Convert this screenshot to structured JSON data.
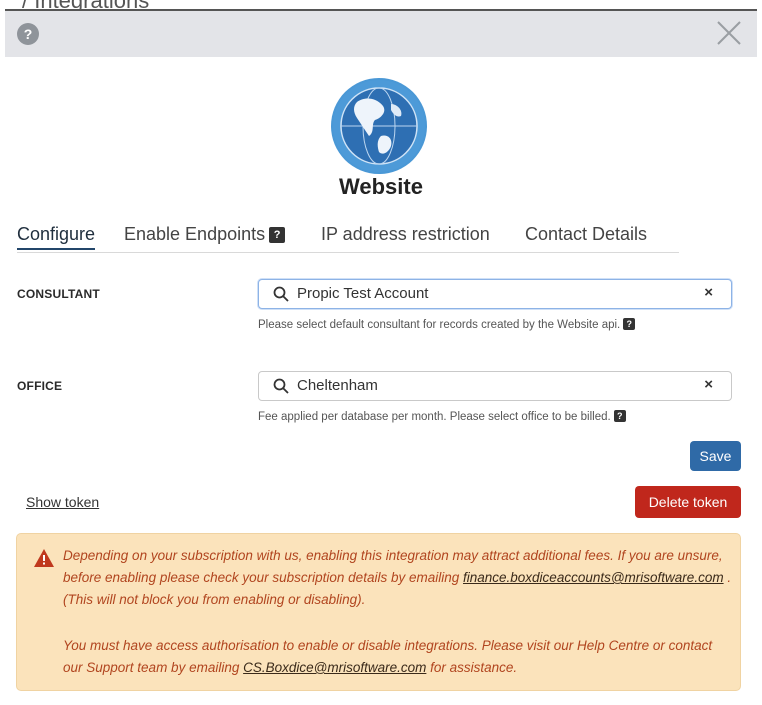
{
  "background_title": "/ Integrations",
  "header": {
    "help_icon": "question-circle-icon",
    "close_icon": "close-x-icon"
  },
  "integration": {
    "name": "Website",
    "logo_icon": "globe-icon"
  },
  "tabs": [
    {
      "label": "Configure",
      "active": true
    },
    {
      "label": "Enable Endpoints",
      "has_help_badge": true
    },
    {
      "label": "IP address restriction"
    },
    {
      "label": "Contact Details"
    }
  ],
  "badge_text": "?",
  "consultant": {
    "label": "CONSULTANT",
    "value": "Propic Test Account",
    "clear": "×",
    "help": "Please select default consultant for records created by the Website api."
  },
  "office": {
    "label": "OFFICE",
    "value": "Cheltenham",
    "clear": "×",
    "help": "Fee applied per database per month. Please select office to be billed."
  },
  "buttons": {
    "save": "Save",
    "delete_token": "Delete token",
    "show_token": "Show token"
  },
  "alert": {
    "icon": "warning-triangle-icon",
    "p1_text": "Depending on your subscription with us, enabling this integration may attract additional fees. If you are unsure, before enabling please check your subscription details by emailing",
    "p1_email": "finance.boxdiceaccounts@mrisoftware.com",
    "p1_suffix": ". (This will not block you from enabling or disabling).",
    "p2_text": "You must have access authorisation to enable or disable integrations. Please visit our Help Centre or contact our Support team by emailing",
    "p2_email": "CS.Boxdice@mrisoftware.com",
    "p2_suffix": "for assistance."
  },
  "colors": {
    "primary": "#2f6aa7",
    "danger": "#c0271c",
    "alert_bg": "#fbe3bb",
    "alert_text": "#b1451f"
  }
}
